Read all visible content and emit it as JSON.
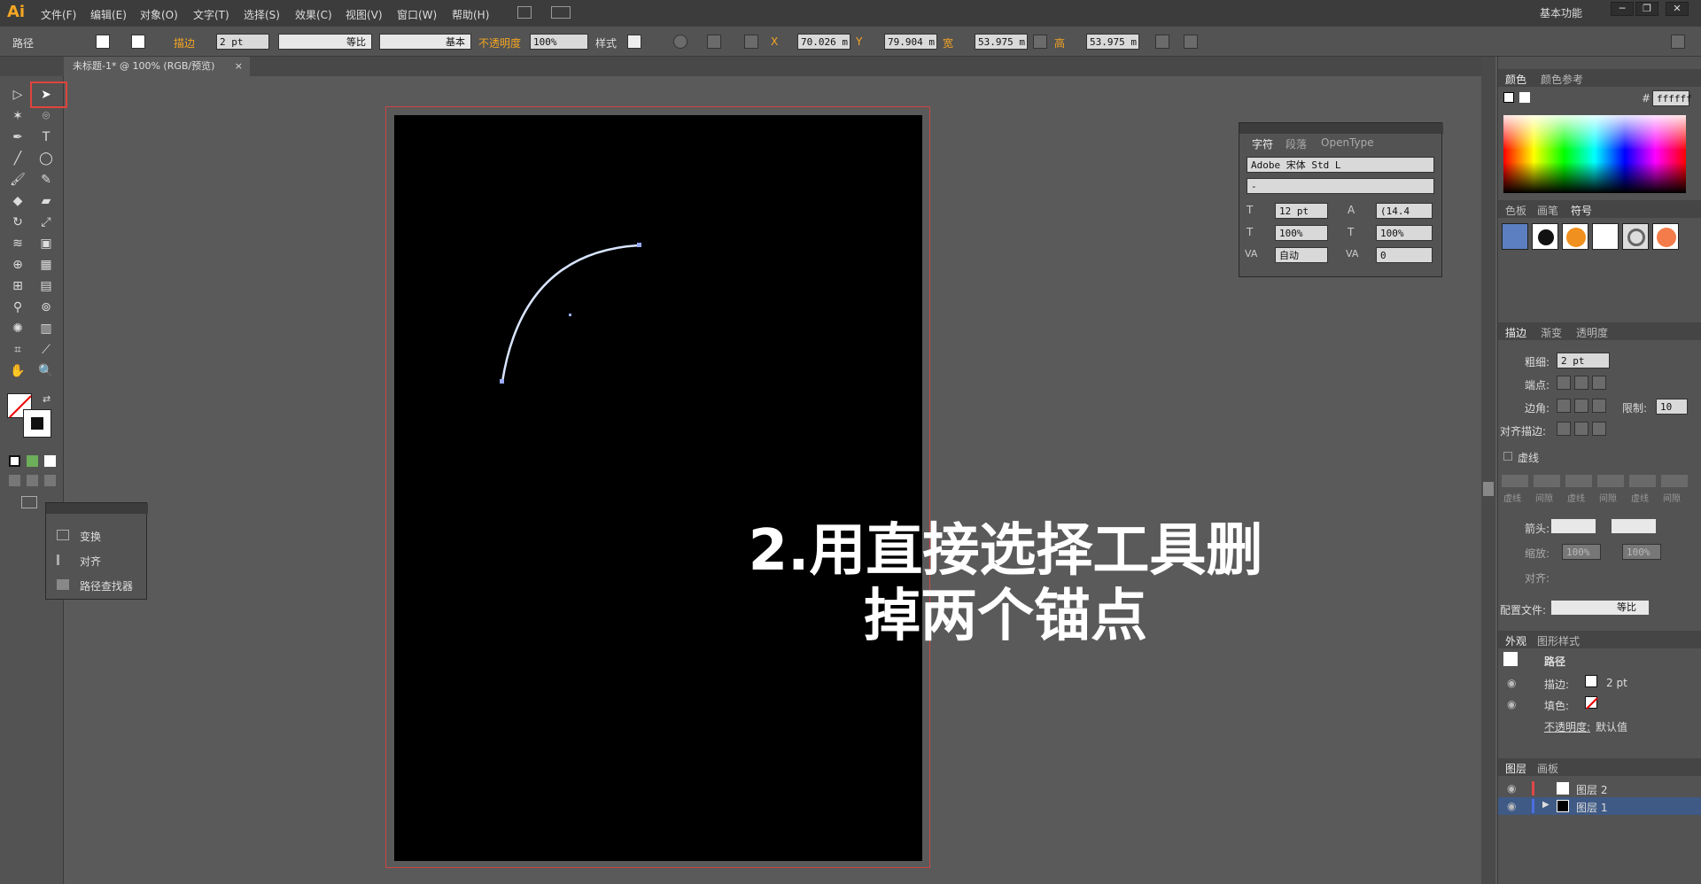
{
  "app": {
    "logo": "Ai",
    "workspace": "基本功能"
  },
  "menu": [
    "文件(F)",
    "编辑(E)",
    "对象(O)",
    "文字(T)",
    "选择(S)",
    "效果(C)",
    "视图(V)",
    "窗口(W)",
    "帮助(H)"
  ],
  "window_buttons": [
    "─",
    "❐",
    "✕"
  ],
  "control_bar": {
    "selection_type": "路径",
    "stroke_label": "描边",
    "stroke_value": "2 pt",
    "profile_label": "等比",
    "brush_label": "基本",
    "opacity_label": "不透明度",
    "opacity_value": "100%",
    "style_label": "样式",
    "x_label": "X",
    "x_value": "70.026 m",
    "y_label": "Y",
    "y_value": "79.904 m",
    "w_label": "宽",
    "w_value": "53.975 m",
    "h_label": "高",
    "h_value": "53.975 m"
  },
  "document_tab": {
    "title": "未标题-1* @ 100% (RGB/预览)",
    "close": "×"
  },
  "float_panel": {
    "items": [
      "变换",
      "对齐",
      "路径查找器"
    ]
  },
  "caption": {
    "line1": "2.用直接选择工具删",
    "line2": "掉两个锚点"
  },
  "char_panel": {
    "tabs": [
      "字符",
      "段落",
      "OpenType"
    ],
    "font_family": "Adobe 宋体 Std L",
    "font_style": "-",
    "font_size": "12 pt",
    "leading": "(14.4",
    "h_scale": "100%",
    "v_scale": "100%",
    "kerning": "自动",
    "tracking": "0"
  },
  "color_panel": {
    "tabs": [
      "颜色",
      "颜色参考"
    ],
    "hex_prefix": "#",
    "hex": "ffffff"
  },
  "swatch_panel": {
    "tabs": [
      "色板",
      "画笔",
      "符号"
    ]
  },
  "stroke_panel": {
    "tabs": [
      "描边",
      "渐变",
      "透明度"
    ],
    "weight_label": "粗细:",
    "weight_value": "2 pt",
    "cap_label": "端点:",
    "corner_label": "边角:",
    "limit_label": "限制:",
    "limit_value": "10",
    "align_label": "对齐描边:",
    "dashed_label": "虚线",
    "dash_headers": [
      "虚线",
      "间隙",
      "虚线",
      "间隙",
      "虚线",
      "间隙"
    ],
    "arrow_label": "箭头:",
    "scale_label": "缩放:",
    "scale_start": "100%",
    "scale_end": "100%",
    "align2_label": "对齐:",
    "profile_label": "配置文件:",
    "profile_value": "等比"
  },
  "appearance_panel": {
    "tabs": [
      "外观",
      "图形样式"
    ],
    "title": "路径",
    "stroke_label": "描边:",
    "stroke_value": "2 pt",
    "fill_label": "填色:",
    "opacity_label": "不透明度:",
    "opacity_value": "默认值"
  },
  "layers_panel": {
    "tabs": [
      "图层",
      "画板"
    ],
    "layers": [
      {
        "name": "图层 2",
        "color": "#e04848"
      },
      {
        "name": "图层 1",
        "color": "#4a6fe0"
      }
    ]
  },
  "colors": {
    "accent": "#f5a623",
    "highlight": "#e0443b",
    "arc": "#d8e4ff"
  }
}
